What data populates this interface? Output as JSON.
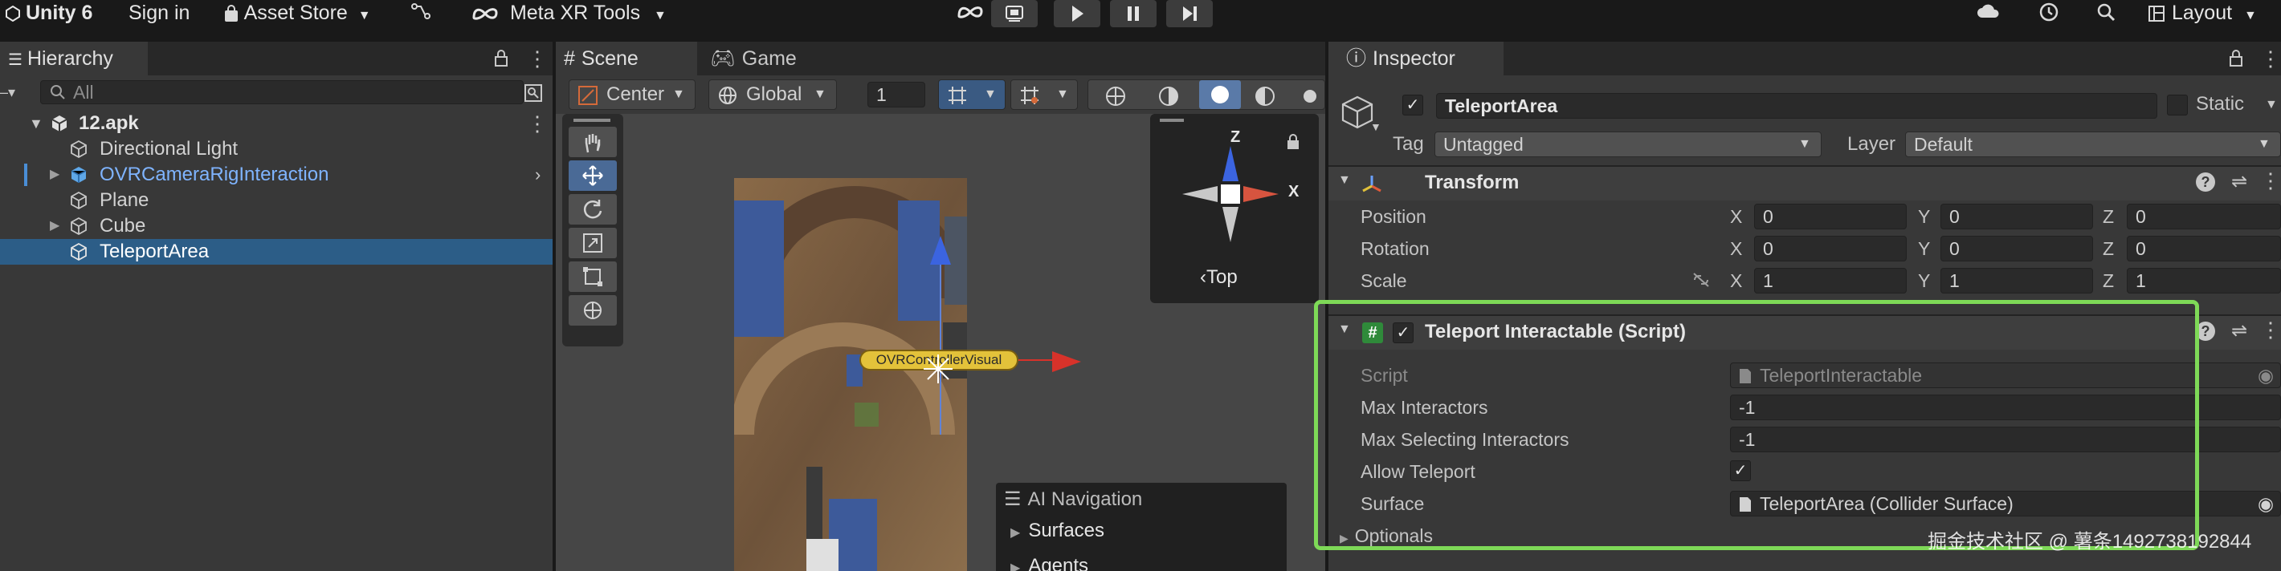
{
  "toolbar": {
    "unity_label": "Unity 6",
    "signin_label": "Sign in",
    "asset_store_label": "Asset Store",
    "meta_xr_label": "Meta XR Tools",
    "layout_label": "Layout"
  },
  "hierarchy": {
    "tab_label": "Hierarchy",
    "search_placeholder": "All",
    "scene_name": "12.apk",
    "items": [
      {
        "label": "Directional Light"
      },
      {
        "label": "OVRCameraRigInteraction"
      },
      {
        "label": "Plane"
      },
      {
        "label": "Cube"
      },
      {
        "label": "TeleportArea"
      }
    ]
  },
  "scene": {
    "tabs": [
      {
        "label": "Scene"
      },
      {
        "label": "Game"
      }
    ],
    "pivot_label": "Center",
    "space_label": "Global",
    "grid_value": "1",
    "gizmo": {
      "y_axis": "Z",
      "x_axis": "X",
      "view_label": "Top"
    },
    "object_label": "OVRControllerVisual",
    "overlay": {
      "title": "AI Navigation",
      "items": [
        {
          "label": "Surfaces"
        },
        {
          "label": "Agents"
        }
      ]
    }
  },
  "inspector": {
    "tab_label": "Inspector",
    "object_name": "TeleportArea",
    "static_label": "Static",
    "tag_label": "Tag",
    "tag_value": "Untagged",
    "layer_label": "Layer",
    "layer_value": "Default",
    "transform": {
      "title": "Transform",
      "rows": [
        {
          "label": "Position",
          "x": "0",
          "y": "0",
          "z": "0"
        },
        {
          "label": "Rotation",
          "x": "0",
          "y": "0",
          "z": "0"
        },
        {
          "label": "Scale",
          "x": "1",
          "y": "1",
          "z": "1"
        }
      ]
    },
    "axis_labels": {
      "x": "X",
      "y": "Y",
      "z": "Z"
    },
    "component": {
      "title": "Teleport Interactable (Script)",
      "script_label": "Script",
      "script_value": "TeleportInteractable",
      "max_interactors_label": "Max Interactors",
      "max_interactors_value": "-1",
      "max_selecting_label": "Max Selecting Interactors",
      "max_selecting_value": "-1",
      "allow_teleport_label": "Allow Teleport",
      "surface_label": "Surface",
      "surface_value": "TeleportArea (Collider Surface)",
      "optionals_label": "Optionals"
    },
    "highlight_color": "#7ed957"
  },
  "watermark": "掘金技术社区 @ 薯条1492738192844"
}
